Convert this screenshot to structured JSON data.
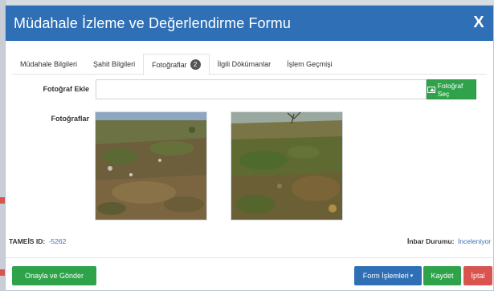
{
  "modal": {
    "title": "Müdahale İzleme ve Değerlendirme Formu",
    "close_label": "X"
  },
  "tabs": [
    {
      "label": "Müdahale Bilgileri",
      "active": false
    },
    {
      "label": "Şahit Bilgileri",
      "active": false
    },
    {
      "label": "Fotoğraflar",
      "active": true,
      "badge": "2"
    },
    {
      "label": "İlgili Dökümanlar",
      "active": false
    },
    {
      "label": "İşlem Geçmişi",
      "active": false
    }
  ],
  "photos_tab": {
    "add_label": "Fotoğraf Ekle",
    "add_value": "",
    "choose_button": "Fotoğraf Seç",
    "photos_label": "Fotoğraflar",
    "thumbnails": [
      "photo-1",
      "photo-2"
    ]
  },
  "info": {
    "id_label": "TAMEİS ID:",
    "id_value": "-5262",
    "status_label": "İnbar Durumu:",
    "status_value": "İnceleniyor"
  },
  "footer": {
    "approve_button": "Onayla ve Gönder",
    "form_actions_button": "Form İşlemleri",
    "save_button": "Kaydet",
    "cancel_button": "İptal"
  },
  "colors": {
    "header": "#2f6fb5",
    "success": "#2fa34a",
    "danger": "#d9534f",
    "link": "#3a6fb0"
  }
}
